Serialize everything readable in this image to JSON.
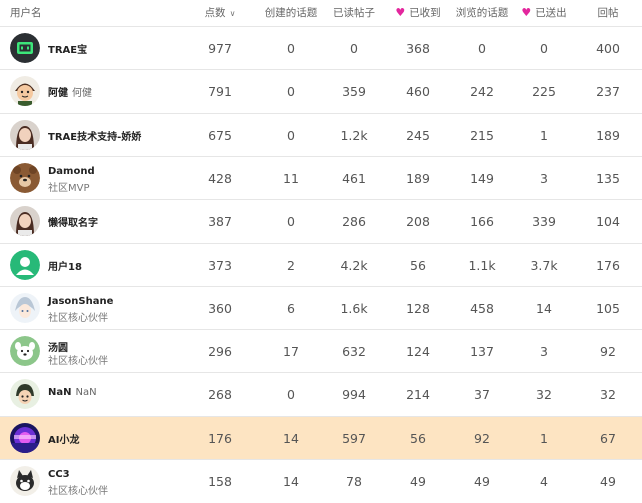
{
  "columns": {
    "user": "用户名",
    "points": "点数",
    "topics_created": "创建的话题",
    "posts_read": "已读帖子",
    "likes_received": "已收到",
    "topics_viewed": "浏览的话题",
    "likes_given": "已送出",
    "replies": "回帖"
  },
  "colors": {
    "heart": "#e3269d",
    "highlight_row": "#fde4c2"
  },
  "rows": [
    {
      "username": "TRAE宝",
      "full_name": "",
      "title": "",
      "points": "977",
      "topics_created": "0",
      "posts_read": "0",
      "likes_received": "368",
      "topics_viewed": "0",
      "likes_given": "0",
      "replies": "400",
      "avatar": "trae-robot-avatar",
      "highlight": false
    },
    {
      "username": "阿健",
      "full_name": "何健",
      "title": "",
      "points": "791",
      "topics_created": "0",
      "posts_read": "359",
      "likes_received": "460",
      "topics_viewed": "242",
      "likes_given": "225",
      "replies": "237",
      "avatar": "cartoon-boy-avatar",
      "highlight": false
    },
    {
      "username": "TRAE技术支持-娇娇",
      "full_name": "",
      "title": "",
      "points": "675",
      "topics_created": "0",
      "posts_read": "1.2k",
      "likes_received": "245",
      "topics_viewed": "215",
      "likes_given": "1",
      "replies": "189",
      "avatar": "photo-avatar",
      "highlight": false
    },
    {
      "username": "Damond",
      "full_name": "",
      "title": "社区MVP",
      "points": "428",
      "topics_created": "11",
      "posts_read": "461",
      "likes_received": "189",
      "topics_viewed": "149",
      "likes_given": "3",
      "replies": "135",
      "avatar": "bear-avatar",
      "highlight": false
    },
    {
      "username": "懒得取名字",
      "full_name": "",
      "title": "",
      "points": "387",
      "topics_created": "0",
      "posts_read": "286",
      "likes_received": "208",
      "topics_viewed": "166",
      "likes_given": "339",
      "replies": "104",
      "avatar": "photo-avatar",
      "highlight": false
    },
    {
      "username": "用户18",
      "full_name": "",
      "title": "",
      "points": "373",
      "topics_created": "2",
      "posts_read": "4.2k",
      "likes_received": "56",
      "topics_viewed": "1.1k",
      "likes_given": "3.7k",
      "replies": "176",
      "avatar": "default-user-avatar",
      "highlight": false
    },
    {
      "username": "JasonShane",
      "full_name": "",
      "title": "社区核心伙伴",
      "points": "360",
      "topics_created": "6",
      "posts_read": "1.6k",
      "likes_received": "128",
      "topics_viewed": "458",
      "likes_given": "14",
      "replies": "105",
      "avatar": "anime-avatar",
      "highlight": false
    },
    {
      "username": "汤圆",
      "full_name": "",
      "title": "社区核心伙伴",
      "points": "296",
      "topics_created": "17",
      "posts_read": "632",
      "likes_received": "124",
      "topics_viewed": "137",
      "likes_given": "3",
      "replies": "92",
      "avatar": "dog-avatar",
      "highlight": false
    },
    {
      "username": "NaN",
      "full_name": "NaN",
      "title": "",
      "points": "268",
      "topics_created": "0",
      "posts_read": "994",
      "likes_received": "214",
      "topics_viewed": "37",
      "likes_given": "32",
      "replies": "32",
      "avatar": "cartoon-girl-avatar",
      "highlight": false
    },
    {
      "username": "AI小龙",
      "full_name": "",
      "title": "",
      "points": "176",
      "topics_created": "14",
      "posts_read": "597",
      "likes_received": "56",
      "topics_viewed": "92",
      "likes_given": "1",
      "replies": "67",
      "avatar": "neon-avatar",
      "highlight": true
    },
    {
      "username": "CC3",
      "full_name": "",
      "title": "社区核心伙伴",
      "points": "158",
      "topics_created": "14",
      "posts_read": "78",
      "likes_received": "49",
      "topics_viewed": "49",
      "likes_given": "4",
      "replies": "49",
      "avatar": "cat-avatar",
      "highlight": false
    }
  ]
}
